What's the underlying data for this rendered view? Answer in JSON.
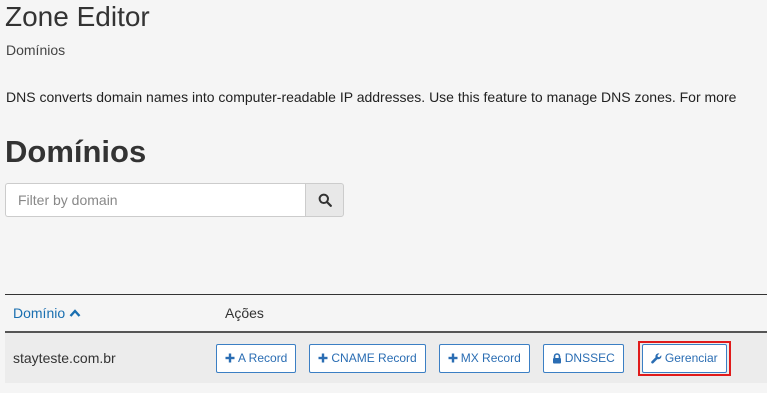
{
  "header": {
    "title": "Zone Editor",
    "breadcrumb": "Domínios"
  },
  "description": "DNS converts domain names into computer-readable IP addresses. Use this feature to manage DNS zones. For more",
  "section": {
    "title": "Domínios"
  },
  "search": {
    "placeholder": "Filter by domain",
    "value": "",
    "icon": "search-icon"
  },
  "table": {
    "columns": {
      "domain": "Domínio",
      "domain_sort_icon": "chevron-up-icon",
      "actions": "Ações"
    },
    "rows": [
      {
        "domain": "stayteste.com.br",
        "actions": {
          "a_record": "A Record",
          "cname_record": "CNAME Record",
          "mx_record": "MX Record",
          "dnssec": "DNSSEC",
          "manage": "Gerenciar"
        }
      }
    ]
  },
  "colors": {
    "accent": "#2a6db3",
    "highlight": "#e01b1b",
    "background": "#f5f5f5"
  }
}
